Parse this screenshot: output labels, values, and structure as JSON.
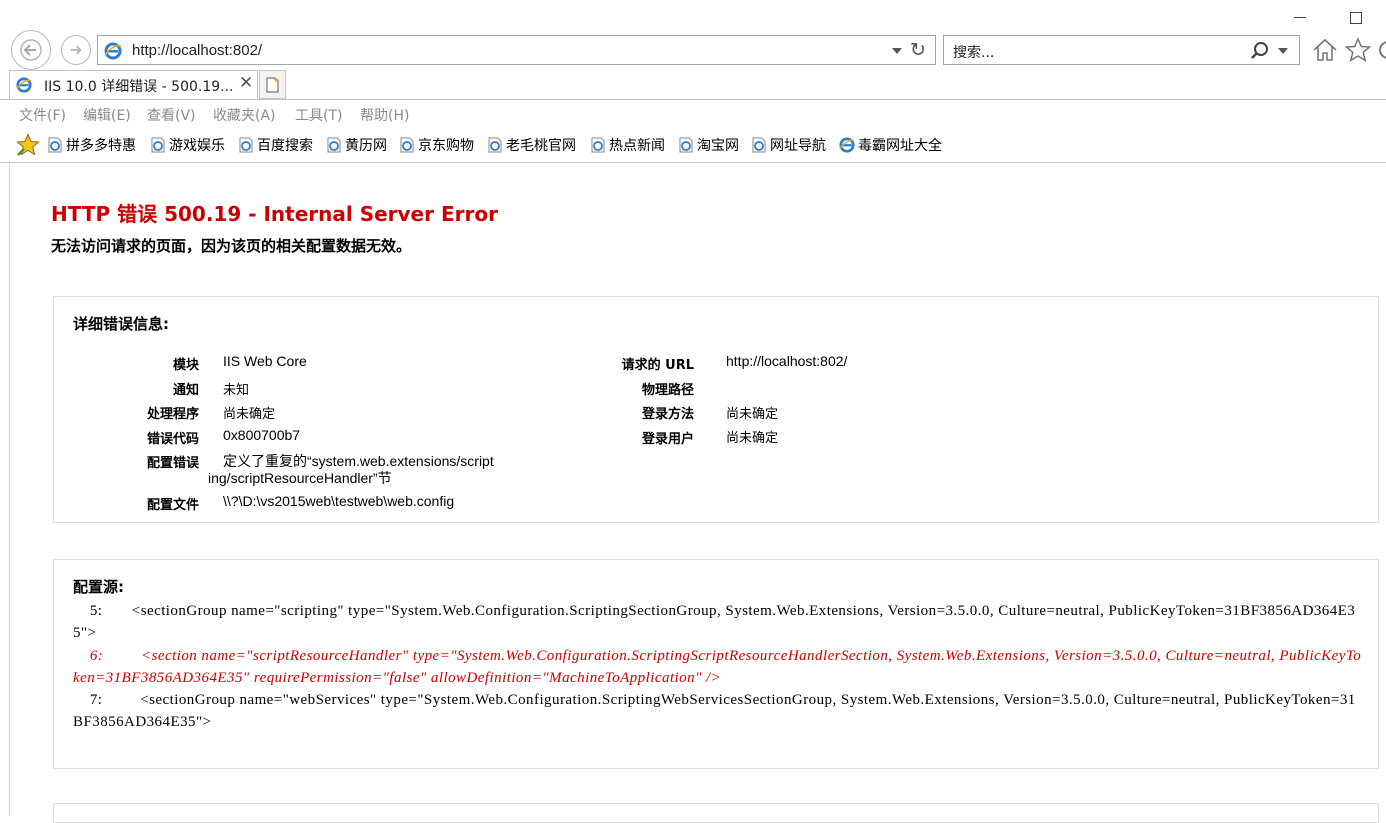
{
  "browser": {
    "address": "http://localhost:802/",
    "search_placeholder": "搜索...",
    "tab_title": "IIS 10.0 详细错误 - 500.19...",
    "menu": [
      "文件(F)",
      "编辑(E)",
      "查看(V)",
      "收藏夹(A)",
      "工具(T)",
      "帮助(H)"
    ],
    "favorites": [
      "拼多多特惠",
      "游戏娱乐",
      "百度搜索",
      "黄历网",
      "京东购物",
      "老毛桃官网",
      "热点新闻",
      "淘宝网",
      "网址导航",
      "毒霸网址大全"
    ],
    "icons": [
      "back-icon",
      "forward-icon",
      "ie-icon",
      "refresh-icon",
      "search-icon",
      "home-icon",
      "favorites-star-icon",
      "gear-icon",
      "close-icon",
      "new-tab-icon"
    ]
  },
  "page": {
    "title": "HTTP 错误 500.19 - Internal Server Error",
    "subtitle": "无法访问请求的页面，因为该页的相关配置数据无效。",
    "details": {
      "heading": "详细错误信息:",
      "left": [
        {
          "label": "模块",
          "value": "IIS Web Core"
        },
        {
          "label": "通知",
          "value": "未知"
        },
        {
          "label": "处理程序",
          "value": "尚未确定"
        },
        {
          "label": "错误代码",
          "value": "0x800700b7"
        },
        {
          "label": "配置错误",
          "value_line1": "定义了重复的“system.web.extensions/script",
          "value_line2": "ing/scriptResourceHandler”节"
        },
        {
          "label": "配置文件",
          "value": "\\\\?\\D:\\vs2015web\\testweb\\web.config"
        }
      ],
      "right": [
        {
          "label": "请求的 URL",
          "value": "http://localhost:802/"
        },
        {
          "label": "物理路径",
          "value": ""
        },
        {
          "label": "登录方法",
          "value": "尚未确定"
        },
        {
          "label": "登录用户",
          "value": "尚未确定"
        }
      ]
    },
    "config_source": {
      "heading": "配置源:",
      "lines": [
        {
          "text": "    5:       <sectionGroup name=\"scripting\" type=\"System.Web.Configuration.ScriptingSectionGroup, System.Web.Extensions, Version=3.5.0.0, Culture=neutral, PublicKeyToken=31BF3856AD364E35\">",
          "error": false
        },
        {
          "text": "    6:         <section name=\"scriptResourceHandler\" type=\"System.Web.Configuration.ScriptingScriptResourceHandlerSection, System.Web.Extensions, Version=3.5.0.0, Culture=neutral, PublicKeyToken=31BF3856AD364E35\" requirePermission=\"false\" allowDefinition=\"MachineToApplication\" />",
          "error": true
        },
        {
          "text": "    7:         <sectionGroup name=\"webServices\" type=\"System.Web.Configuration.ScriptingWebServicesSectionGroup, System.Web.Extensions, Version=3.5.0.0, Culture=neutral, PublicKeyToken=31BF3856AD364E35\">",
          "error": false
        }
      ]
    }
  },
  "colors": {
    "error_red": "#cc0000",
    "box_border": "#dedede",
    "chrome_border": "#c4c4c4",
    "menu_text": "#8a8a8a"
  }
}
